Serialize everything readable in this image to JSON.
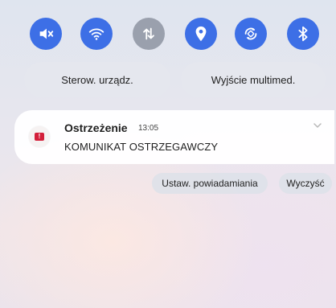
{
  "quick_settings": {
    "tiles": [
      {
        "icon": "mute-icon",
        "active": true
      },
      {
        "icon": "wifi-icon",
        "active": true
      },
      {
        "icon": "mobile-data-icon",
        "active": false
      },
      {
        "icon": "location-icon",
        "active": true
      },
      {
        "icon": "auto-rotate-icon",
        "active": true
      },
      {
        "icon": "bluetooth-icon",
        "active": true
      }
    ],
    "active_color": "#3d6fe6",
    "inactive_color": "#9aa0ad"
  },
  "pills": {
    "device_control": "Sterow. urządz.",
    "media_output": "Wyjście multimed."
  },
  "notification": {
    "app_icon": "alert-app-icon",
    "app_icon_glyph": "!",
    "title": "Ostrzeżenie",
    "time": "13:05",
    "body": "KOMUNIKAT OSTRZEGAWCZY",
    "accent_color": "#d31f3a"
  },
  "actions": {
    "notification_settings": "Ustaw. powiadamiania",
    "clear": "Wyczyść"
  }
}
